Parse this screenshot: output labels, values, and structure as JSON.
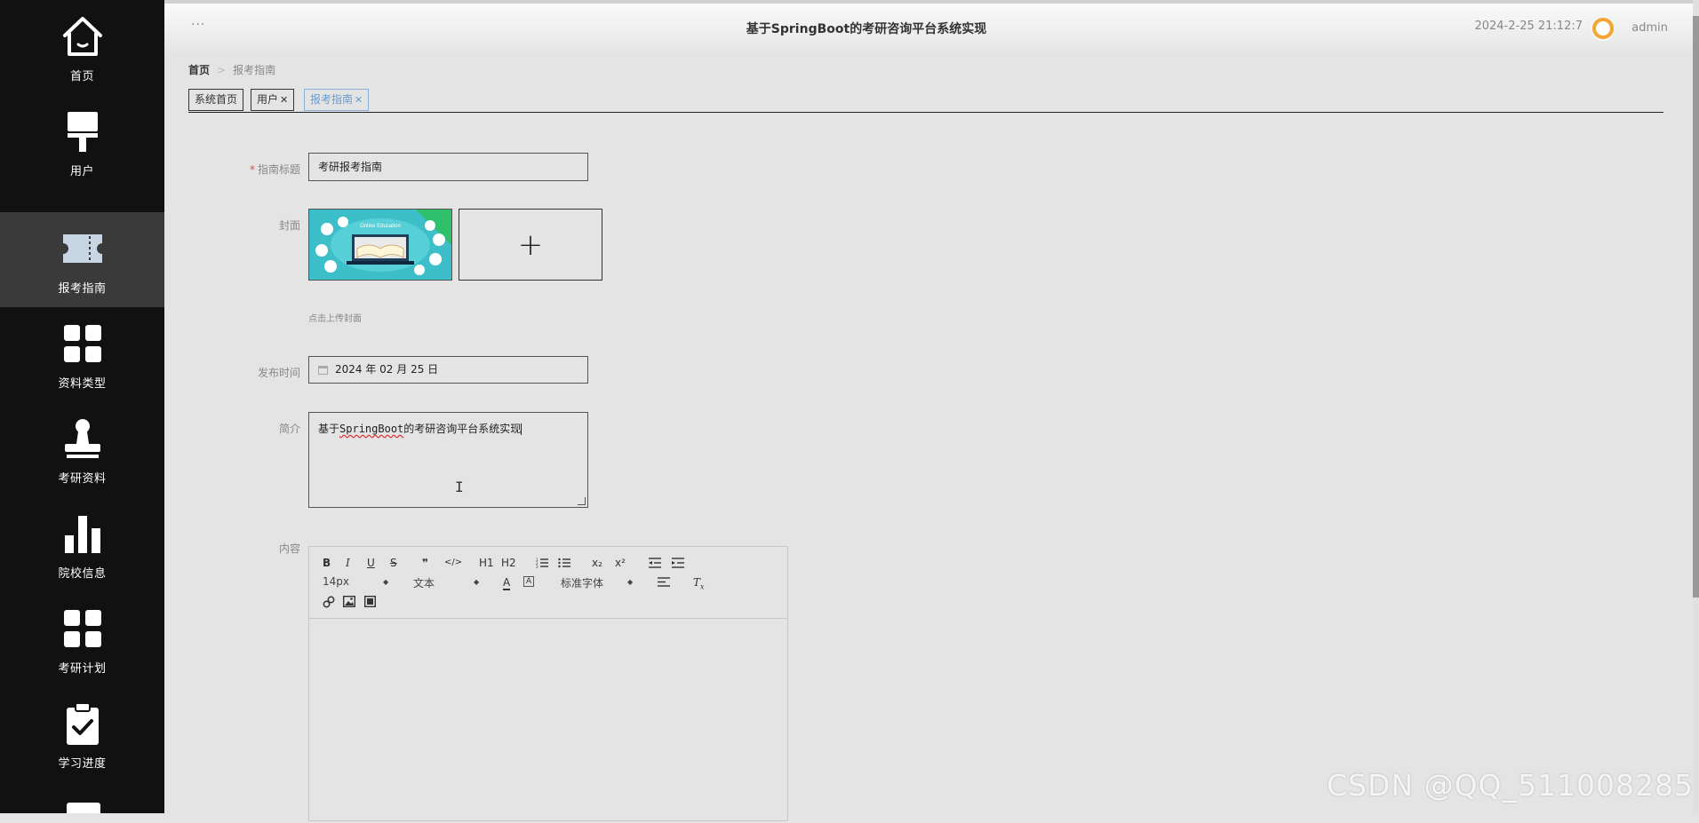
{
  "sidebar": {
    "items": [
      {
        "label": "首页",
        "icon": "home-icon",
        "active": false
      },
      {
        "label": "用户",
        "icon": "brush-icon",
        "active": false
      },
      {
        "label": "报考指南",
        "icon": "ticket-icon",
        "active": true
      },
      {
        "label": "资料类型",
        "icon": "grid-icon",
        "active": false
      },
      {
        "label": "考研资料",
        "icon": "stamp-icon",
        "active": false
      },
      {
        "label": "院校信息",
        "icon": "bar-chart-icon",
        "active": false
      },
      {
        "label": "考研计划",
        "icon": "grid-icon",
        "active": false
      },
      {
        "label": "学习进度",
        "icon": "clipboard-check-icon",
        "active": false
      }
    ]
  },
  "header": {
    "menu_dots": "···",
    "title": "基于SpringBoot的考研咨询平台系统实现",
    "datetime": "2024-2-25 21:12:7",
    "username": "admin"
  },
  "breadcrumb": {
    "home": "首页",
    "separator": ">",
    "current": "报考指南"
  },
  "tabs": [
    {
      "label": "系统首页",
      "closable": false
    },
    {
      "label": "用户",
      "closable": true
    },
    {
      "label": "报考指南",
      "closable": true,
      "active": true
    }
  ],
  "form": {
    "title_label": "指南标题",
    "title_required": "*",
    "title_value": "考研报考指南",
    "cover_label": "封面",
    "cover_image_text": "Online Education",
    "upload_plus": "+",
    "upload_hint": "点击上传封面",
    "date_label": "发布时间",
    "date_value": "2024 年 02 月 25 日",
    "intro_label": "简介",
    "intro_value_prefix": "基于",
    "intro_value_spell": "SpringBoot",
    "intro_value_suffix": "的考研咨询平台系统实现",
    "content_label": "内容"
  },
  "editor": {
    "buttons": [
      "B",
      "I",
      "U",
      "S",
      "❞",
      "</>",
      "H1",
      "H2",
      "ordered-list",
      "bullet-list",
      "x₂",
      "x²",
      "outdent",
      "indent"
    ],
    "font_size": "14px",
    "header_select": "文本",
    "font_family": "标准字体"
  },
  "watermark": "CSDN @QQ_511008285",
  "colors": {
    "sidebar_bg": "#111111",
    "sidebar_active": "#3a3a3a",
    "page_bg": "#e4e4e4",
    "tab_active": "#6a9ad0",
    "required": "#e04b4b"
  }
}
